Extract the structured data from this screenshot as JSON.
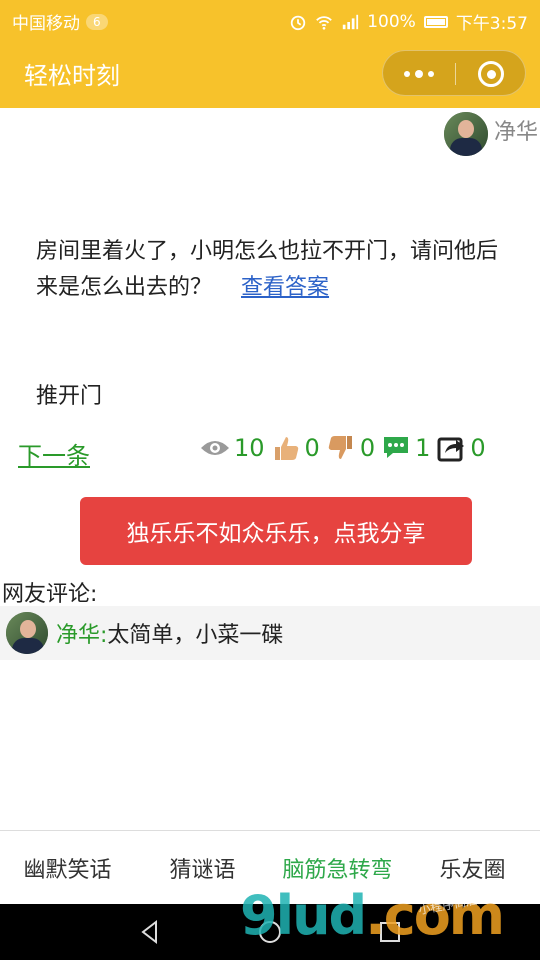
{
  "status_bar": {
    "carrier": "中国移动",
    "sim_badge": "6",
    "battery": "100%",
    "time": "下午3:57"
  },
  "title_bar": {
    "title": "轻松时刻",
    "more_icon": "more-dots-icon",
    "close_icon": "target-close-icon"
  },
  "post": {
    "author_name": "净华",
    "question": "房间里着火了，小明怎么也拉不开门，请问他后来是怎么出去的？",
    "answer_link": "查看答案",
    "answer": "推开门"
  },
  "actions": {
    "next_label": "下一条",
    "views": "10",
    "likes": "0",
    "dislikes": "0",
    "comments": "1",
    "shares": "0"
  },
  "share_button": "独乐乐不如众乐乐，点我分享",
  "comments": {
    "title": "网友评论:",
    "items": [
      {
        "name": "净华:",
        "text": "太简单，小菜一碟"
      }
    ]
  },
  "tabs": [
    {
      "label": "幽默笑话",
      "active": false
    },
    {
      "label": "猜谜语",
      "active": false
    },
    {
      "label": "脑筋急转弯",
      "active": true
    },
    {
      "label": "乐友圈",
      "active": false
    }
  ],
  "watermark": {
    "main": "9lud",
    "suffix": ".com",
    "small": "小程序商店"
  },
  "colors": {
    "brand": "#f7c22b",
    "accent_green": "#2a9a2a",
    "share_red": "#e64340",
    "link_blue": "#2c62c8"
  }
}
